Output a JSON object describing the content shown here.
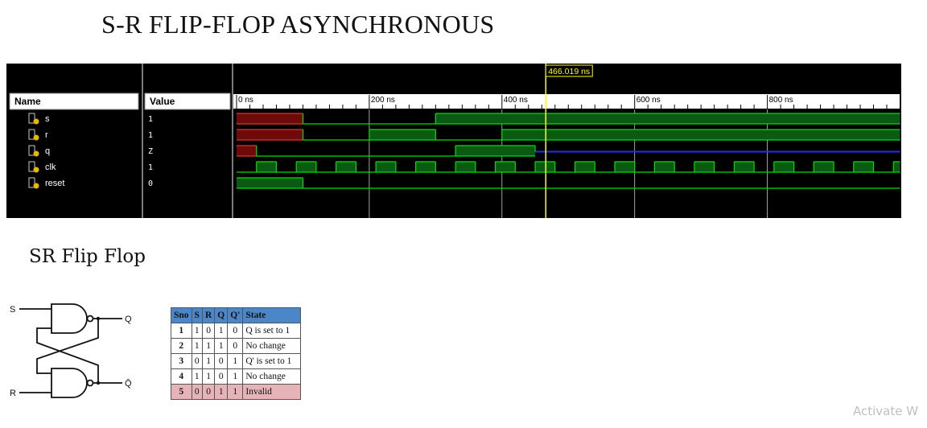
{
  "page": {
    "title": "S-R FLIP-FLOP ASYNCHRONOUS",
    "subtitle": "SR Flip Flop",
    "watermark": "Activate W"
  },
  "simulator": {
    "colors": {
      "background": "#000000",
      "header_bg": "#ffffff",
      "signal_high_fill": "#0a5a14",
      "signal_line": "#00e000",
      "undefined_fill": "#6e0a0a",
      "undefined_line": "#e03030",
      "highz_line": "#2a2af0",
      "cursor": "#ffff00",
      "gridline": "#c8c8c8"
    },
    "name_header": "Name",
    "value_header": "Value",
    "cursor_label": "466.019 ns",
    "cursor_time_ns": 466.019,
    "time_range_ns": [
      0,
      1000
    ],
    "time_labels": [
      {
        "t": 0,
        "text": "0 ns"
      },
      {
        "t": 200,
        "text": "200 ns"
      },
      {
        "t": 400,
        "text": "400 ns"
      },
      {
        "t": 600,
        "text": "600 ns"
      },
      {
        "t": 800,
        "text": "800 ns"
      }
    ],
    "signals": [
      {
        "name": "s",
        "value": "1",
        "icon": "signal-icon",
        "segments": [
          {
            "from": 0,
            "to": 100,
            "state": "x"
          },
          {
            "from": 100,
            "to": 300,
            "state": "0"
          },
          {
            "from": 300,
            "to": 1000,
            "state": "1"
          }
        ]
      },
      {
        "name": "r",
        "value": "1",
        "icon": "signal-icon",
        "segments": [
          {
            "from": 0,
            "to": 100,
            "state": "x"
          },
          {
            "from": 100,
            "to": 200,
            "state": "0"
          },
          {
            "from": 200,
            "to": 300,
            "state": "1"
          },
          {
            "from": 300,
            "to": 400,
            "state": "0"
          },
          {
            "from": 400,
            "to": 1000,
            "state": "1"
          }
        ]
      },
      {
        "name": "q",
        "value": "Z",
        "icon": "output-signal-icon",
        "segments": [
          {
            "from": 0,
            "to": 30,
            "state": "x"
          },
          {
            "from": 30,
            "to": 330,
            "state": "0"
          },
          {
            "from": 330,
            "to": 450,
            "state": "1"
          },
          {
            "from": 450,
            "to": 1000,
            "state": "z"
          }
        ]
      },
      {
        "name": "clk",
        "value": "1",
        "icon": "signal-icon",
        "clock": {
          "period": 60,
          "offset": 30
        }
      },
      {
        "name": "reset",
        "value": "0",
        "icon": "signal-icon",
        "segments": [
          {
            "from": 0,
            "to": 100,
            "state": "1"
          },
          {
            "from": 100,
            "to": 1000,
            "state": "0"
          }
        ]
      }
    ]
  },
  "flipflop_diagram": {
    "input_s": "S",
    "input_r": "R",
    "output_q": "Q",
    "output_qbar": "Q̄"
  },
  "truth_table": {
    "headers": [
      "Sno",
      "S",
      "R",
      "Q",
      "Q'",
      "State"
    ],
    "rows": [
      {
        "sno": "1",
        "s": "1",
        "r": "0",
        "q": "1",
        "qbar": "0",
        "state": "Q is set to 1"
      },
      {
        "sno": "2",
        "s": "1",
        "r": "1",
        "q": "1",
        "qbar": "0",
        "state": "No change"
      },
      {
        "sno": "3",
        "s": "0",
        "r": "1",
        "q": "0",
        "qbar": "1",
        "state": "Q' is set to 1"
      },
      {
        "sno": "4",
        "s": "1",
        "r": "1",
        "q": "0",
        "qbar": "1",
        "state": "No change"
      },
      {
        "sno": "5",
        "s": "0",
        "r": "0",
        "q": "1",
        "qbar": "1",
        "state": "Invalid"
      }
    ],
    "colors": {
      "header": "#4a86c8",
      "invalid_row": "#e6b4b8"
    }
  }
}
